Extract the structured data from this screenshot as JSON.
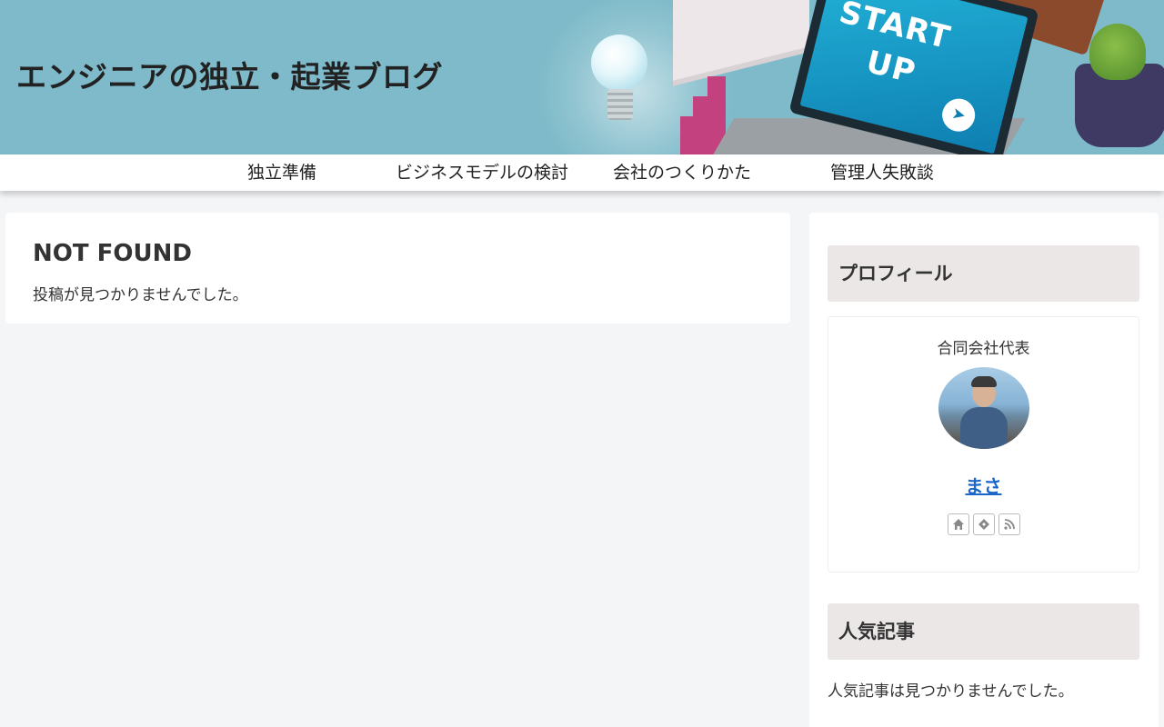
{
  "header": {
    "site_title": "エンジニアの独立・起業ブログ",
    "banner_text_1": "START",
    "banner_text_2": "UP"
  },
  "nav": {
    "items": [
      {
        "label": "独立準備"
      },
      {
        "label": "ビジネスモデルの検討"
      },
      {
        "label": "会社のつくりかた"
      },
      {
        "label": "管理人失敗談"
      }
    ]
  },
  "main": {
    "title": "NOT FOUND",
    "message": "投稿が見つかりませんでした。"
  },
  "sidebar": {
    "profile": {
      "heading": "プロフィール",
      "role": "合同会社代表",
      "name": "まさ",
      "social_icons": [
        "home-icon",
        "feedly-icon",
        "rss-icon"
      ]
    },
    "popular": {
      "heading": "人気記事",
      "message": "人気記事は見つかりませんでした。"
    }
  },
  "colors": {
    "header_bg": "#7ebac9",
    "page_bg": "#f4f5f7",
    "widget_head_bg": "#ebe7e7",
    "link": "#1a66c9"
  }
}
